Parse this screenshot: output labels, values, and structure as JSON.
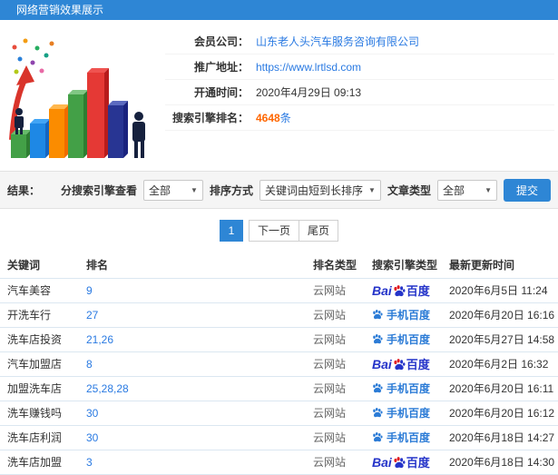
{
  "colors": {
    "accent": "#2e86d5",
    "link": "#2a7ae2",
    "highlight": "#ff6600",
    "baidu_blue": "#2534c9",
    "baidu_red": "#e11a21",
    "mobile_baidu_blue": "#2b7bd6"
  },
  "header": {
    "title": "网络营销效果展示"
  },
  "info": {
    "rows": [
      {
        "label": "会员公司：",
        "value": "山东老人头汽车服务咨询有限公司"
      },
      {
        "label": "推广地址：",
        "value": "https://www.lrtlsd.com"
      },
      {
        "label": "开通时间：",
        "value": "2020年4月29日 09:13"
      },
      {
        "label": "搜索引擎排名：",
        "value": "4648",
        "suffix": "条"
      }
    ]
  },
  "filters": {
    "result_label": "结果：",
    "engine_label": "分搜索引擎查看",
    "engine_value": "全部",
    "sort_label": "排序方式",
    "sort_value": "关键词由短到长排序",
    "type_label": "文章类型",
    "type_value": "全部",
    "submit_label": "提交"
  },
  "pagination": {
    "current": "1",
    "next_label": "下一页",
    "last_label": "尾页"
  },
  "table": {
    "headers": [
      "关键词",
      "排名",
      "排名类型",
      "搜索引擎类型",
      "最新更新时间"
    ],
    "engine_labels": {
      "baidu_bai": "Bai",
      "baidu_du": "百度",
      "mobile_baidu": "手机百度"
    },
    "rows": [
      {
        "keyword": "汽车美容",
        "rank": "9",
        "rank_type": "云网站",
        "engine": "baidu",
        "time": "2020年6月5日 11:24"
      },
      {
        "keyword": "开洗车行",
        "rank": "27",
        "rank_type": "云网站",
        "engine": "mobile-baidu",
        "time": "2020年6月20日 16:16"
      },
      {
        "keyword": "洗车店投资",
        "rank": "21,26",
        "rank_type": "云网站",
        "engine": "mobile-baidu",
        "time": "2020年5月27日 14:58"
      },
      {
        "keyword": "汽车加盟店",
        "rank": "8",
        "rank_type": "云网站",
        "engine": "baidu",
        "time": "2020年6月2日 16:32"
      },
      {
        "keyword": "加盟洗车店",
        "rank": "25,28,28",
        "rank_type": "云网站",
        "engine": "mobile-baidu",
        "time": "2020年6月20日 16:11"
      },
      {
        "keyword": "洗车赚钱吗",
        "rank": "30",
        "rank_type": "云网站",
        "engine": "mobile-baidu",
        "time": "2020年6月20日 16:12"
      },
      {
        "keyword": "洗车店利润",
        "rank": "30",
        "rank_type": "云网站",
        "engine": "mobile-baidu",
        "time": "2020年6月18日 14:27"
      },
      {
        "keyword": "洗车店加盟",
        "rank": "3",
        "rank_type": "云网站",
        "engine": "baidu",
        "time": "2020年6月18日 14:30"
      }
    ]
  }
}
